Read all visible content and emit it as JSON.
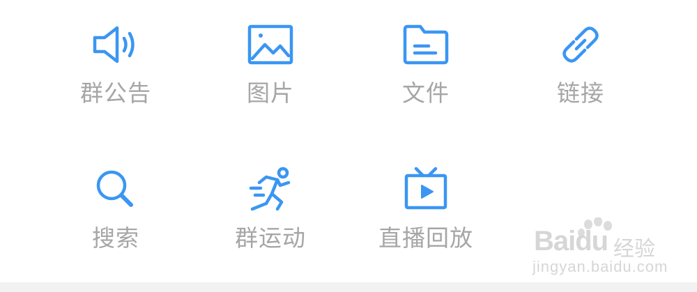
{
  "theme": {
    "icon_color": "#3a96f2",
    "label_color": "#a6a6a6",
    "background": "#ffffff",
    "bottom_bar": "#f2f2f2"
  },
  "grid": {
    "items": [
      {
        "label": "群公告",
        "icon": "speaker-icon"
      },
      {
        "label": "图片",
        "icon": "image-icon"
      },
      {
        "label": "文件",
        "icon": "folder-icon"
      },
      {
        "label": "链接",
        "icon": "link-icon"
      },
      {
        "label": "搜索",
        "icon": "search-icon"
      },
      {
        "label": "群运动",
        "icon": "running-icon"
      },
      {
        "label": "直播回放",
        "icon": "tv-play-icon"
      }
    ]
  },
  "watermark": {
    "brand": "Baidu",
    "suffix": "经验",
    "url": "jingyan.baidu.com"
  }
}
